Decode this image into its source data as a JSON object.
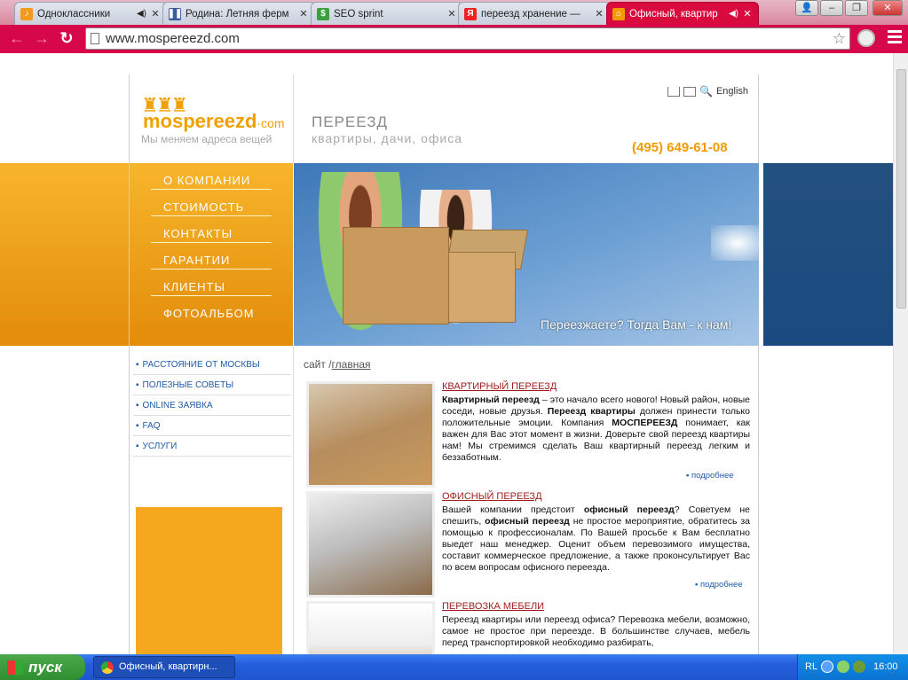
{
  "browser": {
    "tabs": [
      {
        "title": "Одноклассники",
        "favicon": "music-note-icon",
        "active": false
      },
      {
        "title": "Родина: Летняя ферм",
        "favicon": "pause-icon",
        "active": false
      },
      {
        "title": "SEO sprint",
        "favicon": "dollar-icon",
        "active": false
      },
      {
        "title": "переезд хранение — ",
        "favicon": "yandex-icon",
        "active": false
      },
      {
        "title": "Офисный, квартир",
        "favicon": "domes-icon",
        "active": true
      }
    ],
    "url": "www.mospereezd.com"
  },
  "site": {
    "logo_text": "mospereezd",
    "logo_domain": "·com",
    "slogan": "Мы меняем адреса вещей",
    "heading": "ПЕРЕЕЗД",
    "subheading": "квартиры, дачи, офиса",
    "phone": "(495) 649-61-08",
    "lang_link": "English",
    "main_menu": [
      "О КОМПАНИИ",
      "СТОИМОСТЬ",
      "КОНТАКТЫ",
      "ГАРАНТИИ",
      "КЛИЕНТЫ",
      "ФОТОАЛЬБОМ"
    ],
    "banner_caption": "Переезжаете? Тогда Вам - к нам!",
    "side_menu": [
      "РАССТОЯНИЕ ОТ МОСКВЫ",
      "ПОЛЕЗНЫЕ СОВЕТЫ",
      "ONLINE ЗАЯВКА",
      "FAQ",
      "УСЛУГИ"
    ],
    "breadcrumb_prefix": "сайт /",
    "breadcrumb_link": "главная",
    "more_label": "подробнее",
    "articles": [
      {
        "title": "КВАРТИРНЫЙ ПЕРЕЕЗД",
        "parts": [
          {
            "b": "Квартирный переезд"
          },
          {
            "t": " – это начало всего нового! Новый район, новые соседи, новые друзья. "
          },
          {
            "b": "Переезд квартиры"
          },
          {
            "t": " должен принести только положительные эмоции. Компания "
          },
          {
            "b": "МОСПЕРЕЕЗД"
          },
          {
            "t": " понимает, как важен для Вас этот момент в жизни. Доверьте свой переезд квартиры нам! Мы стремимся сделать Ваш квартирный переезд легким и беззаботным."
          }
        ]
      },
      {
        "title": "ОФИСНЫЙ ПЕРЕЕЗД",
        "parts": [
          {
            "t": "Вашей компании предстоит "
          },
          {
            "b": "офисный переезд"
          },
          {
            "t": "? Советуем не спешить, "
          },
          {
            "b": "офисный переезд"
          },
          {
            "t": " не простое мероприятие, обратитесь за помощью к профессионалам. По Вашей просьбе к Вам бесплатно выедет наш менеджер. Оценит объем перевозимого имущества, составит коммерческое предложение, а также проконсультирует Вас по всем вопросам офисного переезда."
          }
        ]
      },
      {
        "title": "ПЕРЕВОЗКА МЕБЕЛИ",
        "parts": [
          {
            "t": "Переезд квартиры или переезд офиса? Перевозка мебели, возможно, самое не простое при переезде. В большинстве случаев, мебель перед транспортировкой необходимо разбирать,"
          }
        ]
      }
    ]
  },
  "taskbar": {
    "start_label": "пуск",
    "window_title": "Офисный, квартирн...",
    "lang": "RL",
    "clock": "16:00"
  },
  "colors": {
    "chrome_accent": "#d6084a",
    "site_orange": "#f29b00",
    "link_blue": "#1f5aa8",
    "title_red": "#a31d1d"
  }
}
